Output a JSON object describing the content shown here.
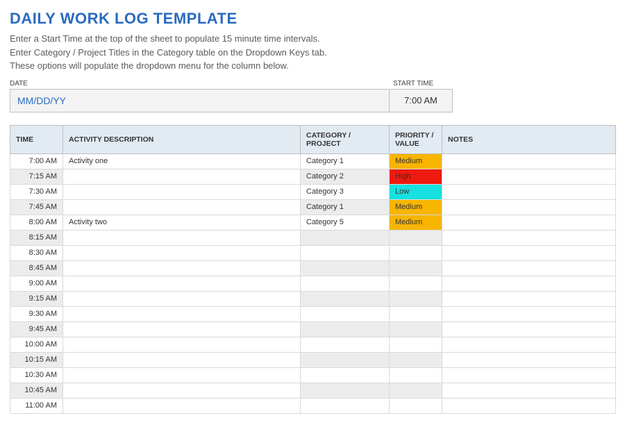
{
  "title": "DAILY WORK LOG TEMPLATE",
  "instructions": {
    "line1": "Enter a Start Time at the top of the sheet to populate 15 minute time intervals.",
    "line2": "Enter Category / Project Titles in the Category table on the Dropdown Keys tab.",
    "line3": "These options will populate the dropdown menu for the column below."
  },
  "labels": {
    "date": "DATE",
    "start_time": "START TIME"
  },
  "meta": {
    "date_placeholder": "MM/DD/YY",
    "start_time": "7:00 AM"
  },
  "columns": {
    "time": "TIME",
    "activity": "ACTIVITY DESCRIPTION",
    "category": "CATEGORY / PROJECT",
    "priority": "PRIORITY / VALUE",
    "notes": "NOTES"
  },
  "rows": [
    {
      "time": "7:00 AM",
      "activity": "Activity one",
      "category": "Category 1",
      "priority": "Medium",
      "notes": ""
    },
    {
      "time": "7:15 AM",
      "activity": "",
      "category": "Category 2",
      "priority": "High",
      "notes": ""
    },
    {
      "time": "7:30 AM",
      "activity": "",
      "category": "Category 3",
      "priority": "Low",
      "notes": ""
    },
    {
      "time": "7:45 AM",
      "activity": "",
      "category": "Category 1",
      "priority": "Medium",
      "notes": ""
    },
    {
      "time": "8:00 AM",
      "activity": "Activity two",
      "category": "Category 5",
      "priority": "Medium",
      "notes": ""
    },
    {
      "time": "8:15 AM",
      "activity": "",
      "category": "",
      "priority": "",
      "notes": ""
    },
    {
      "time": "8:30 AM",
      "activity": "",
      "category": "",
      "priority": "",
      "notes": ""
    },
    {
      "time": "8:45 AM",
      "activity": "",
      "category": "",
      "priority": "",
      "notes": ""
    },
    {
      "time": "9:00 AM",
      "activity": "",
      "category": "",
      "priority": "",
      "notes": ""
    },
    {
      "time": "9:15 AM",
      "activity": "",
      "category": "",
      "priority": "",
      "notes": ""
    },
    {
      "time": "9:30 AM",
      "activity": "",
      "category": "",
      "priority": "",
      "notes": ""
    },
    {
      "time": "9:45 AM",
      "activity": "",
      "category": "",
      "priority": "",
      "notes": ""
    },
    {
      "time": "10:00 AM",
      "activity": "",
      "category": "",
      "priority": "",
      "notes": ""
    },
    {
      "time": "10:15 AM",
      "activity": "",
      "category": "",
      "priority": "",
      "notes": ""
    },
    {
      "time": "10:30 AM",
      "activity": "",
      "category": "",
      "priority": "",
      "notes": ""
    },
    {
      "time": "10:45 AM",
      "activity": "",
      "category": "",
      "priority": "",
      "notes": ""
    },
    {
      "time": "11:00 AM",
      "activity": "",
      "category": "",
      "priority": "",
      "notes": ""
    }
  ]
}
